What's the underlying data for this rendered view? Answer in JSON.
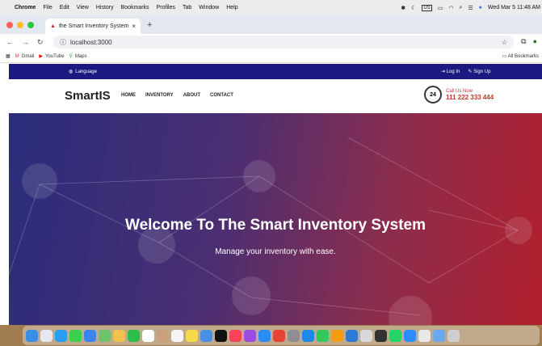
{
  "menubar": {
    "app": "Chrome",
    "items": [
      "File",
      "Edit",
      "View",
      "History",
      "Bookmarks",
      "Profiles",
      "Tab",
      "Window",
      "Help"
    ],
    "status": "US",
    "datetime": "Wed Mar 5  11:48 AM"
  },
  "browser": {
    "tab_title": "the Smart Inventory System",
    "url": "localhost:3000",
    "bookmarks": [
      "Gmail",
      "YouTube",
      "Maps"
    ],
    "all_bookmarks": "All Bookmarks"
  },
  "site": {
    "language": "Language",
    "login": "Log In",
    "signup": "Sign Up",
    "logo": "SmartIS",
    "nav": [
      "HOME",
      "INVENTORY",
      "ABOUT",
      "CONTACT"
    ],
    "call_label": "Call Us Now",
    "call_number": "111 222 333 444",
    "call_icon_text": "24",
    "hero_title": "Welcome To The Smart Inventory System",
    "hero_subtitle": "Manage your inventory with ease."
  },
  "colors": {
    "topbar": "#1a1a80",
    "accent": "#c0392b",
    "hero_start": "#2a2d7c",
    "hero_end": "#b11f2d"
  },
  "dock": [
    "finder",
    "launchpad",
    "safari",
    "messages",
    "mail",
    "maps",
    "photos",
    "facetime",
    "calendar",
    "contacts",
    "reminders",
    "notes",
    "freeform",
    "tv",
    "music",
    "podcasts",
    "app-store",
    "chrome",
    "settings",
    "xcode",
    "numbers",
    "pages",
    "vscode",
    "preview",
    "activity-monitor",
    "whatsapp",
    "zoom",
    "finder-folder",
    "downloads",
    "trash"
  ]
}
